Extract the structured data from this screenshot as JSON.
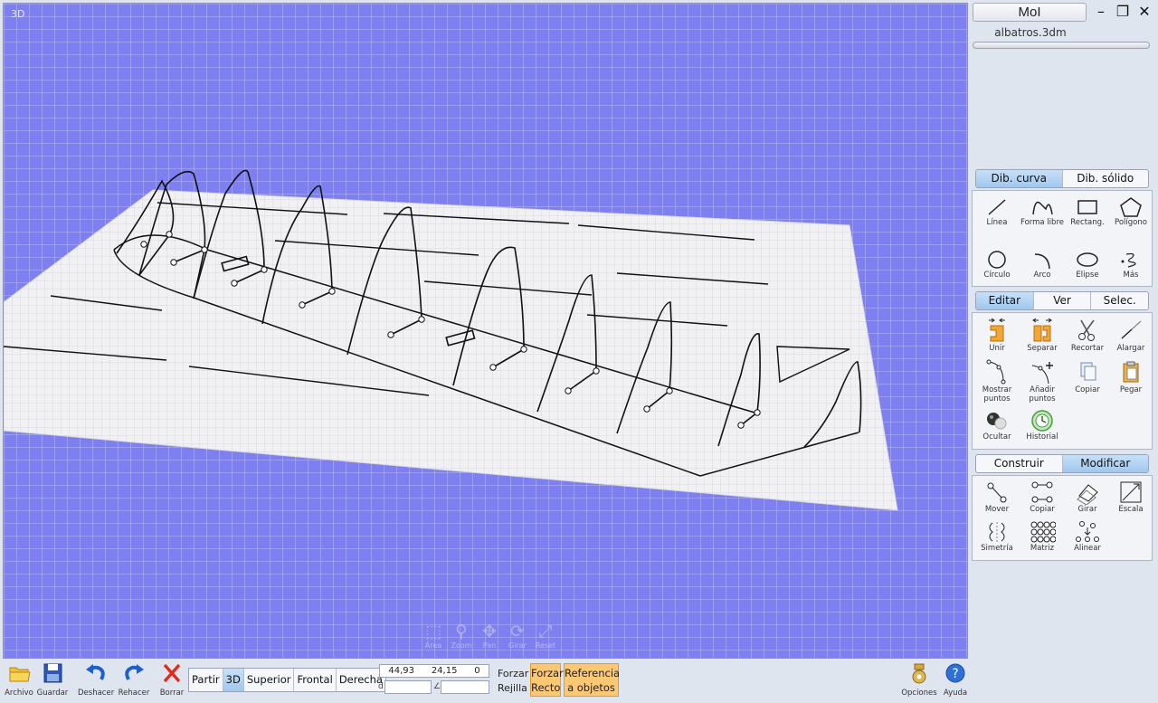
{
  "app": {
    "title": "MoI",
    "file_name": "albatros.3dm",
    "window_controls": {
      "minimize": "–",
      "restore": "❐",
      "close": "✕"
    }
  },
  "viewport": {
    "label": "3D",
    "nav_widgets": [
      {
        "name": "area",
        "label": "Área",
        "glyph": "⬚"
      },
      {
        "name": "zoom",
        "label": "Zoom",
        "glyph": "⚲"
      },
      {
        "name": "pan",
        "label": "Pan",
        "glyph": "✥"
      },
      {
        "name": "girar",
        "label": "Girar",
        "glyph": "⟳"
      },
      {
        "name": "reset",
        "label": "Reset",
        "glyph": "⤢"
      }
    ]
  },
  "draw_tabs": [
    {
      "label": "Dib. curva",
      "active": true
    },
    {
      "label": "Dib. sólido",
      "active": false
    }
  ],
  "draw_tools": [
    {
      "label": "Línea",
      "icon": "line-icon"
    },
    {
      "label": "Forma libre",
      "icon": "freeform-icon"
    },
    {
      "label": "Rectang.",
      "icon": "rectangle-icon"
    },
    {
      "label": "Polígono",
      "icon": "polygon-icon"
    },
    {
      "label": "Círculo",
      "icon": "circle-icon"
    },
    {
      "label": "Arco",
      "icon": "arc-icon"
    },
    {
      "label": "Elipse",
      "icon": "ellipse-icon"
    },
    {
      "label": "Más",
      "icon": "more-icon"
    }
  ],
  "edit_tabs": [
    {
      "label": "Editar",
      "active": true
    },
    {
      "label": "Ver",
      "active": false
    },
    {
      "label": "Selec.",
      "active": false
    }
  ],
  "edit_tools": [
    {
      "label": "Unir",
      "icon": "join-icon"
    },
    {
      "label": "Separar",
      "icon": "separate-icon"
    },
    {
      "label": "Recortar",
      "icon": "scissors-icon"
    },
    {
      "label": "Alargar",
      "icon": "extend-icon"
    },
    {
      "label": "Mostrar puntos",
      "icon": "show-points-icon"
    },
    {
      "label": "Añadir puntos",
      "icon": "add-points-icon"
    },
    {
      "label": "Copiar",
      "icon": "copy-icon"
    },
    {
      "label": "Pegar",
      "icon": "paste-icon"
    },
    {
      "label": "Ocultar",
      "icon": "hide-icon"
    },
    {
      "label": "Historial",
      "icon": "history-icon"
    }
  ],
  "transform_tabs": [
    {
      "label": "Construir",
      "active": false
    },
    {
      "label": "Modificar",
      "active": true
    }
  ],
  "transform_tools": [
    {
      "label": "Mover",
      "icon": "move-icon"
    },
    {
      "label": "Copiar",
      "icon": "copy-transform-icon"
    },
    {
      "label": "Girar",
      "icon": "rotate-icon"
    },
    {
      "label": "Escala",
      "icon": "scale-icon"
    },
    {
      "label": "Simetría",
      "icon": "mirror-icon"
    },
    {
      "label": "Matriz",
      "icon": "array-icon"
    },
    {
      "label": "Alinear",
      "icon": "align-icon"
    }
  ],
  "bottom": {
    "file_buttons": [
      {
        "label": "Archivo",
        "icon": "folder-icon"
      },
      {
        "label": "Guardar",
        "icon": "save-icon"
      },
      {
        "label": "Deshacer",
        "icon": "undo-icon"
      },
      {
        "label": "Rehacer",
        "icon": "redo-icon"
      },
      {
        "label": "Borrar",
        "icon": "delete-icon"
      }
    ],
    "view_tabs": [
      {
        "label": "Partir",
        "active": false
      },
      {
        "label": "3D",
        "active": true
      },
      {
        "label": "Superior",
        "active": false
      },
      {
        "label": "Frontal",
        "active": false
      },
      {
        "label": "Derecha",
        "active": false
      }
    ],
    "coords": {
      "x": "44,93",
      "y": "24,15",
      "z": "0"
    },
    "distance_label": "d",
    "angle_label": "∠",
    "snap": {
      "grid_label": "Forzar Rejilla",
      "ortho_label": "Forzar Recto",
      "object_label": "Referencia a objetos"
    },
    "options_label": "Opciones",
    "help_label": "Ayuda"
  },
  "colors": {
    "viewport_bg": "#7e7ff0",
    "active_tab": "#a9cff1",
    "snap_button": "#fcc874"
  }
}
